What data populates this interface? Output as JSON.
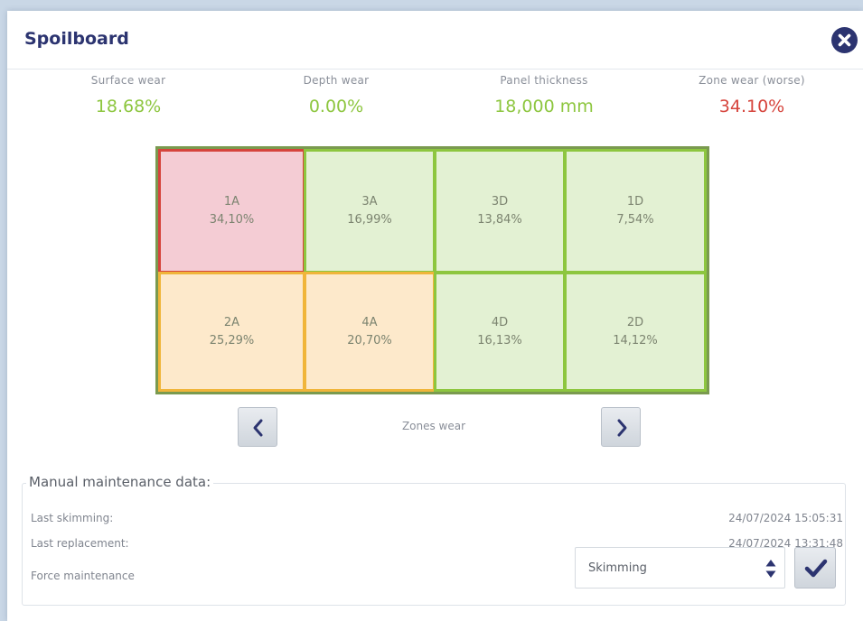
{
  "dialog": {
    "title": "Spoilboard"
  },
  "metrics": {
    "surface_wear": {
      "label": "Surface wear",
      "value": "18.68%",
      "status": "ok"
    },
    "depth_wear": {
      "label": "Depth wear",
      "value": "0.00%",
      "status": "ok"
    },
    "panel_thickness": {
      "label": "Panel thickness",
      "value": "18,000 mm",
      "status": "ok"
    },
    "zone_wear_worse": {
      "label": "Zone wear (worse)",
      "value": "34.10%",
      "status": "alert"
    }
  },
  "zones": {
    "caption": "Zones wear",
    "row1": [
      {
        "name": "1A",
        "wear": "34,10%",
        "status": "red"
      },
      {
        "name": "3A",
        "wear": "16,99%",
        "status": "green"
      },
      {
        "name": "3D",
        "wear": "13,84%",
        "status": "green"
      },
      {
        "name": "1D",
        "wear": "7,54%",
        "status": "green"
      }
    ],
    "row2": [
      {
        "name": "2A",
        "wear": "25,29%",
        "status": "orange"
      },
      {
        "name": "4A",
        "wear": "20,70%",
        "status": "orange"
      },
      {
        "name": "4D",
        "wear": "16,13%",
        "status": "green"
      },
      {
        "name": "2D",
        "wear": "14,12%",
        "status": "green"
      }
    ]
  },
  "icons": {
    "close": "close-icon",
    "previous": "chevron-left-icon",
    "next": "chevron-right-icon",
    "select": "sort-arrows-icon",
    "confirm": "checkmark-icon"
  },
  "colors": {
    "title": "#2c3470",
    "ok": "#8dc63f",
    "alert": "#d6443c",
    "warning": "#f0b53a"
  },
  "maintenance": {
    "title": "Manual maintenance data:",
    "last_skimming": {
      "label": "Last skimming:",
      "value": "24/07/2024 15:05:31"
    },
    "last_replacement": {
      "label": "Last replacement:",
      "value": "24/07/2024 13:31:48"
    },
    "force": {
      "label": "Force maintenance",
      "selected": "Skimming"
    }
  }
}
